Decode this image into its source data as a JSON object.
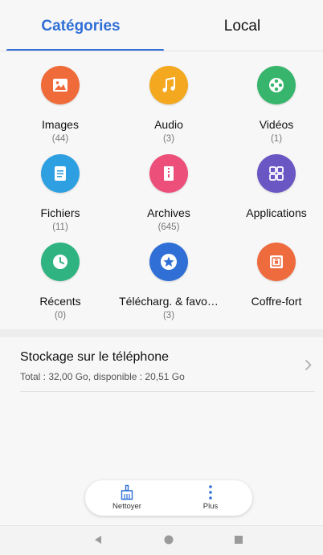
{
  "tabs": {
    "categories": "Catégories",
    "local": "Local"
  },
  "colors": {
    "accent": "#2f6fd6"
  },
  "categories": [
    {
      "label": "Images",
      "count": "(44)",
      "color": "#ef6b3a",
      "icon": "image-icon"
    },
    {
      "label": "Audio",
      "count": "(3)",
      "color": "#f3a81f",
      "icon": "music-note-icon"
    },
    {
      "label": "Vidéos",
      "count": "(1)",
      "color": "#37b56c",
      "icon": "film-reel-icon"
    },
    {
      "label": "Fichiers",
      "count": "(11)",
      "color": "#2ea0e1",
      "icon": "document-icon"
    },
    {
      "label": "Archives",
      "count": "(645)",
      "color": "#ec4f7a",
      "icon": "archive-icon"
    },
    {
      "label": "Applications",
      "count": "",
      "color": "#6b57c4",
      "icon": "apps-grid-icon"
    },
    {
      "label": "Récents",
      "count": "(0)",
      "color": "#2fb381",
      "icon": "clock-icon"
    },
    {
      "label": "Télécharg. & favo…",
      "count": "(3)",
      "color": "#2f6fd6",
      "icon": "star-icon"
    },
    {
      "label": "Coffre-fort",
      "count": "",
      "color": "#ee6b3e",
      "icon": "safe-icon"
    }
  ],
  "storage": {
    "title": "Stockage sur le téléphone",
    "subtitle": "Total : 32,00  Go, disponible : 20,51  Go"
  },
  "bottom_bar": {
    "clean_label": "Nettoyer",
    "more_label": "Plus"
  },
  "navbar": {
    "back_icon": "back-triangle-icon",
    "home_icon": "home-circle-icon",
    "recents_icon": "recents-square-icon"
  }
}
